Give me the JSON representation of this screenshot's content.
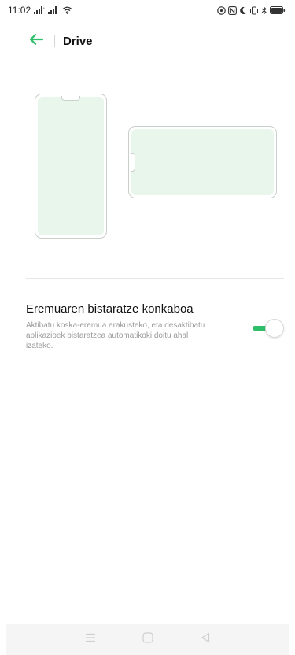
{
  "status_bar": {
    "time": "11:02",
    "icons": [
      "signal-icon",
      "signal-icon",
      "wifi-icon",
      "nfc-icon",
      "n-badge-icon",
      "moon-icon",
      "vibrate-icon",
      "bluetooth-icon",
      "battery-icon"
    ]
  },
  "header": {
    "title": "Drive",
    "back_icon": "arrow-left-icon",
    "accent_color": "#2fbf6b"
  },
  "preview": {
    "screen_color": "#e9f6ec",
    "frame_color": "#c9cfcb"
  },
  "setting": {
    "title": "Eremuaren bistaratze konkaboa",
    "description": "Aktibatu koska-eremua erakusteko, eta desaktibatu aplikazioek bistaratzea automatikoki doitu ahal izateko.",
    "toggle_on": true
  },
  "nav_bar": {
    "icons": [
      "menu-icon",
      "home-icon",
      "back-triangle-icon"
    ]
  }
}
